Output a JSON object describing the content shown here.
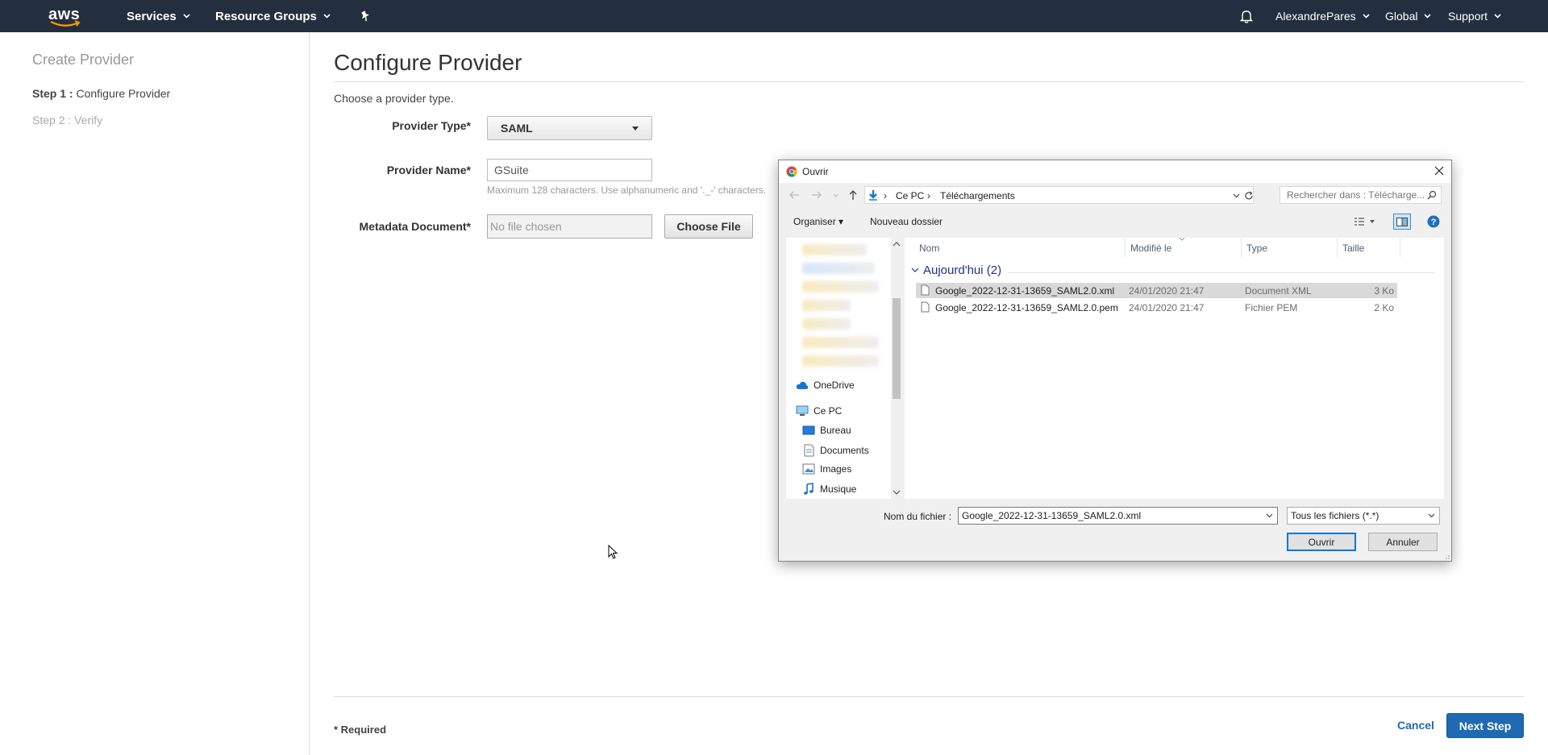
{
  "topnav": {
    "logo": "aws",
    "services": "Services",
    "resource_groups": "Resource Groups",
    "user": "AlexandrePares",
    "region": "Global",
    "support": "Support"
  },
  "sidebar": {
    "title": "Create Provider",
    "steps": [
      {
        "prefix": "Step 1 :",
        "label": "Configure Provider"
      },
      {
        "prefix": "",
        "label": "Step 2 : Verify"
      }
    ]
  },
  "main": {
    "title": "Configure Provider",
    "subtitle": "Choose a provider type.",
    "provider_type": {
      "label": "Provider Type",
      "value": "SAML"
    },
    "provider_name": {
      "label": "Provider Name",
      "value": "GSuite",
      "help": "Maximum 128 characters. Use alphanumeric and '._-' characters."
    },
    "metadata": {
      "label": "Metadata Document",
      "placeholder": "No file chosen",
      "button": "Choose File"
    },
    "required_asterisk": "*",
    "required_note": "* Required",
    "cancel": "Cancel",
    "next": "Next Step"
  },
  "dialog": {
    "title": "Ouvrir",
    "address": [
      "Ce PC",
      "Téléchargements"
    ],
    "search_placeholder": "Rechercher dans : Télécharge...",
    "toolbar": {
      "organize": "Organiser",
      "new_folder": "Nouveau dossier"
    },
    "nav": [
      {
        "label": "OneDrive",
        "icon": "cloud-icon"
      },
      {
        "label": "Ce PC",
        "icon": "computer-icon"
      },
      {
        "label": "Bureau",
        "icon": "desktop-icon"
      },
      {
        "label": "Documents",
        "icon": "documents-icon"
      },
      {
        "label": "Images",
        "icon": "images-icon"
      },
      {
        "label": "Musique",
        "icon": "music-icon"
      }
    ],
    "columns": [
      "Nom",
      "Modifié le",
      "Type",
      "Taille"
    ],
    "group": "Aujourd'hui (2)",
    "files": [
      {
        "name": "Google_2022-12-31-13659_SAML2.0.xml",
        "modified": "24/01/2020 21:47",
        "type": "Document XML",
        "size": "3 Ko",
        "selected": true
      },
      {
        "name": "Google_2022-12-31-13659_SAML2.0.pem",
        "modified": "24/01/2020 21:47",
        "type": "Fichier PEM",
        "size": "2 Ko",
        "selected": false
      }
    ],
    "filename_label": "Nom du fichier :",
    "filename_value": "Google_2022-12-31-13659_SAML2.0.xml",
    "filetype": "Tous les fichiers (*.*)",
    "open": "Ouvrir",
    "cancel": "Annuler"
  },
  "colors": {
    "nav_bg": "#232f3e",
    "primary": "#1f6ab2",
    "group_header": "#1e3287"
  }
}
